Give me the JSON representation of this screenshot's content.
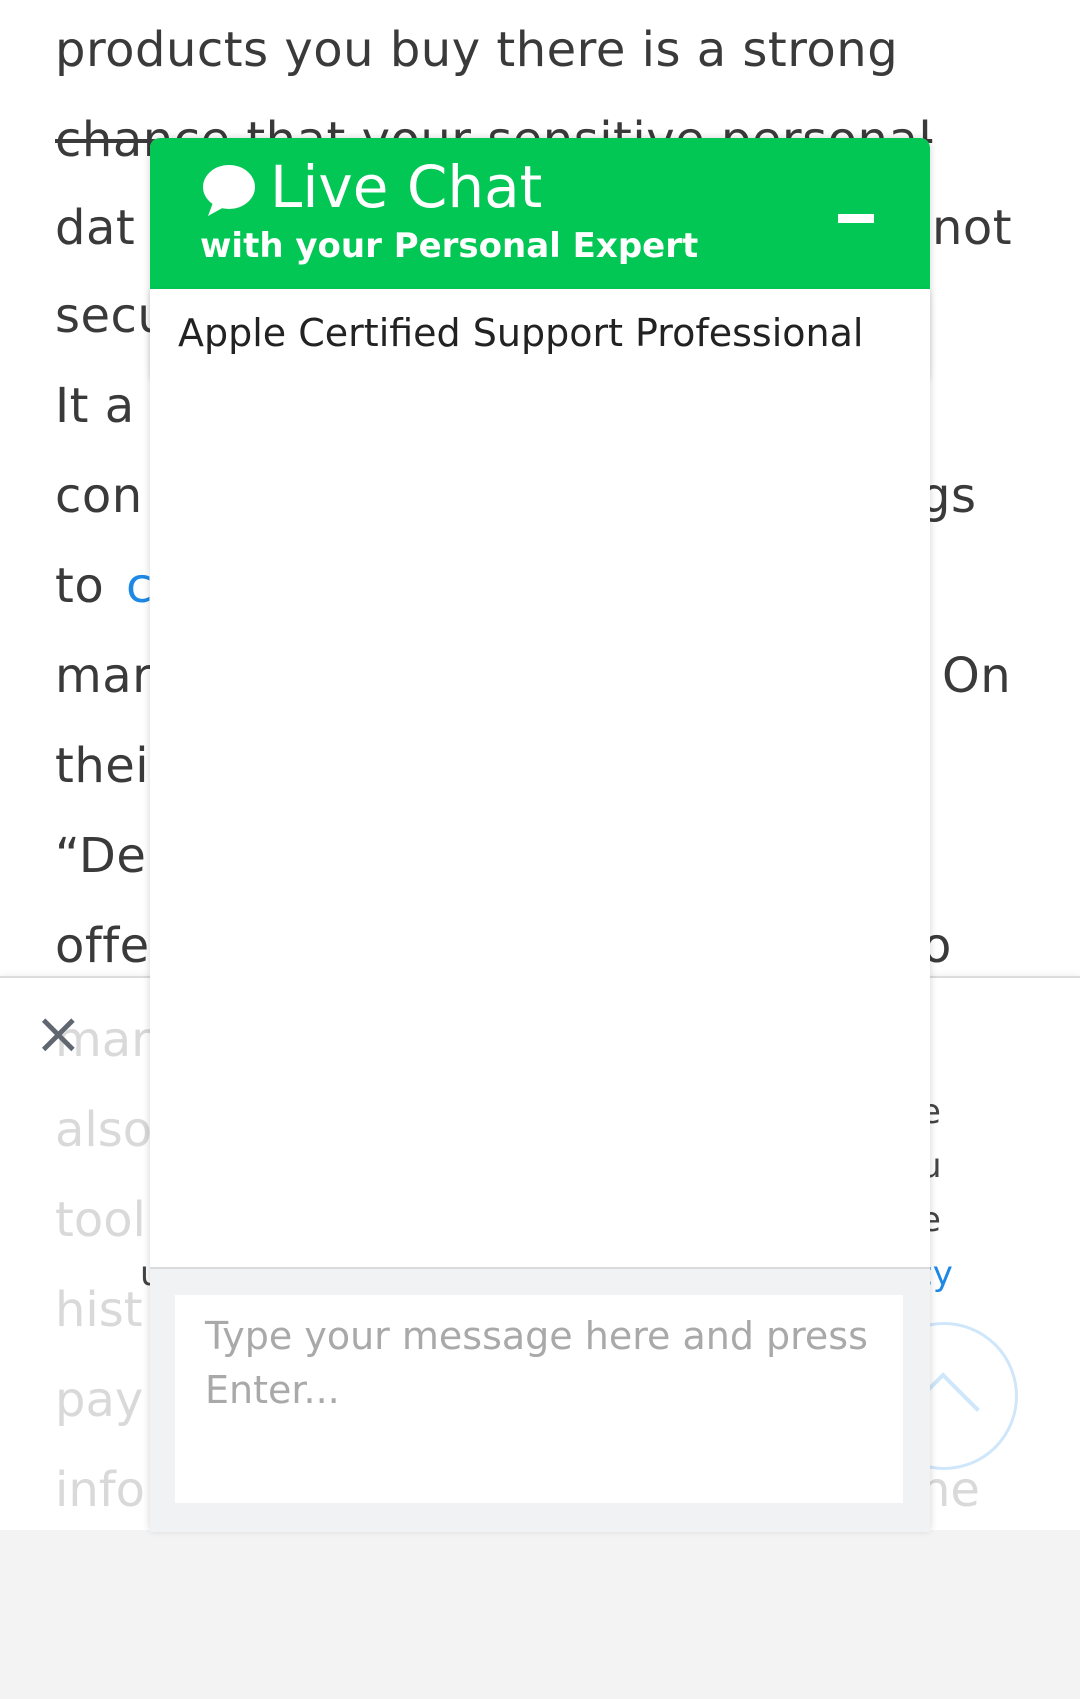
{
  "article": {
    "lines": [
      "products you buy there is a strong",
      "chance that your sensitive personal",
      "dat",
      "secu",
      "It a",
      "con",
      "to ",
      "mar",
      "thei",
      "“De",
      "offe"
    ],
    "right_fragments": {
      "line3": "not",
      "line6": "gs",
      "line8": "On",
      "line11": "o"
    },
    "link_fragment": "c",
    "faded_lines": [
      "mar",
      "also",
      "tool",
      "hist",
      "pay",
      "info"
    ],
    "faded_right": {
      "line6": "ne"
    }
  },
  "banner": {
    "close_symbol": "×",
    "fragments_right": [
      "e",
      "u",
      "e"
    ],
    "fragment_left": "u",
    "link_right": "cy"
  },
  "chat": {
    "title": "Live Chat",
    "subtitle": "with your Personal Expert",
    "agent_label": "Apple Certified Support Professional",
    "input_placeholder": "Type your message here and press Enter...",
    "header_color": "#02c754"
  },
  "icons": {
    "chat": "chat-bubble-icon",
    "minimize": "minimize-icon",
    "close": "close-icon",
    "scroll_top": "chevron-up-icon"
  }
}
